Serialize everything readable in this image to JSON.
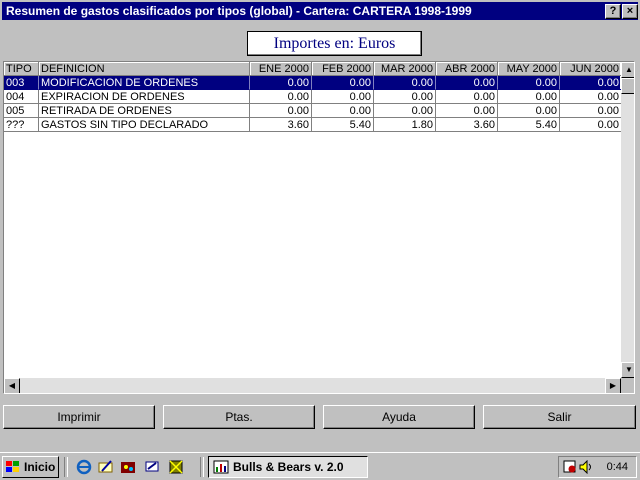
{
  "window": {
    "title": "Resumen de gastos clasificados por tipos (global) - Cartera: CARTERA 1998-1999",
    "help_label": "?",
    "close_label": "×"
  },
  "currency_label": "Importes en:  Euros",
  "table": {
    "headers": [
      "TIPO",
      "DEFINICION",
      "ENE 2000",
      "FEB 2000",
      "MAR 2000",
      "ABR 2000",
      "MAY 2000",
      "JUN 2000"
    ],
    "rows": [
      {
        "selected": true,
        "cells": [
          "003",
          "MODIFICACION DE ORDENES",
          "0.00",
          "0.00",
          "0.00",
          "0.00",
          "0.00",
          "0.00"
        ]
      },
      {
        "selected": false,
        "cells": [
          "004",
          "EXPIRACION DE ORDENES",
          "0.00",
          "0.00",
          "0.00",
          "0.00",
          "0.00",
          "0.00"
        ]
      },
      {
        "selected": false,
        "cells": [
          "005",
          "RETIRADA DE ORDENES",
          "0.00",
          "0.00",
          "0.00",
          "0.00",
          "0.00",
          "0.00"
        ]
      },
      {
        "selected": false,
        "cells": [
          "???",
          "GASTOS SIN TIPO DECLARADO",
          "3.60",
          "5.40",
          "1.80",
          "3.60",
          "5.40",
          "0.00"
        ]
      }
    ]
  },
  "buttons": {
    "imprimir": "Imprimir",
    "ptas": "Ptas.",
    "ayuda": "Ayuda",
    "salir": "Salir"
  },
  "taskbar": {
    "start_label": "Inicio",
    "task_label": "Bulls & Bears v. 2.0",
    "clock": "0:44"
  },
  "colors": {
    "titlebar": "#000080",
    "selection": "#000080",
    "face": "#c0c0c0"
  }
}
